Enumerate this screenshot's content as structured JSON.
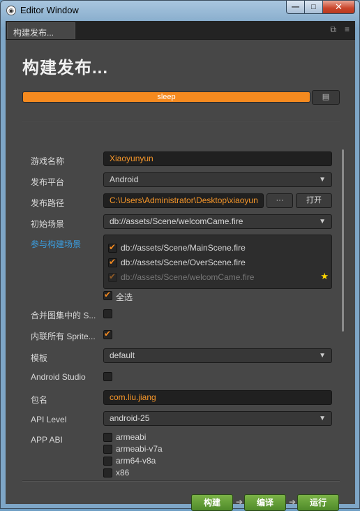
{
  "window": {
    "title": "Editor Window",
    "min": "—",
    "max": "□",
    "close": "✕"
  },
  "tab": {
    "label": "构建发布...",
    "icons": [
      "⧉",
      "≡"
    ]
  },
  "page": {
    "title": "构建发布..."
  },
  "progress": {
    "status": "sleep",
    "value": 1.0,
    "button_icon": "▤"
  },
  "form": {
    "game_name": {
      "label": "游戏名称",
      "value": "Xiaoyunyun"
    },
    "platform": {
      "label": "发布平台",
      "value": "Android"
    },
    "build_path": {
      "label": "发布路径",
      "value": "C:\\Users\\Administrator\\Desktop\\xiaoyun",
      "browse": "···",
      "open": "打开"
    },
    "start_scene": {
      "label": "初始场景",
      "value": "db://assets/Scene/welcomCame.fire"
    },
    "scenes": {
      "label": "参与构建场景",
      "items": [
        {
          "path": "db://assets/Scene/MainScene.fire",
          "checked": true
        },
        {
          "path": "db://assets/Scene/OverScene.fire",
          "checked": true
        },
        {
          "path": "db://assets/Scene/welcomCame.fire",
          "checked": true
        }
      ],
      "select_all": "全选"
    },
    "merge_atlas": {
      "label": "合并图集中的 S..."
    },
    "inline_sprite": {
      "label": "内联所有 Sprite..."
    },
    "template": {
      "label": "模板",
      "value": "default"
    },
    "android_studio": {
      "label": "Android Studio"
    },
    "package": {
      "label": "包名",
      "value": "com.liu.jiang"
    },
    "api_level": {
      "label": "API Level",
      "value": "android-25"
    },
    "app_abi": {
      "label": "APP ABI",
      "options": [
        "armeabi",
        "armeabi-v7a",
        "arm64-v8a",
        "x86"
      ]
    }
  },
  "actions": {
    "build": "构建",
    "compile": "编译",
    "run": "运行",
    "arrow": "➔"
  },
  "colors": {
    "accent": "#f58a1f",
    "link": "#3b9ee0",
    "panel": "#474747",
    "green": "#6aa83a"
  }
}
